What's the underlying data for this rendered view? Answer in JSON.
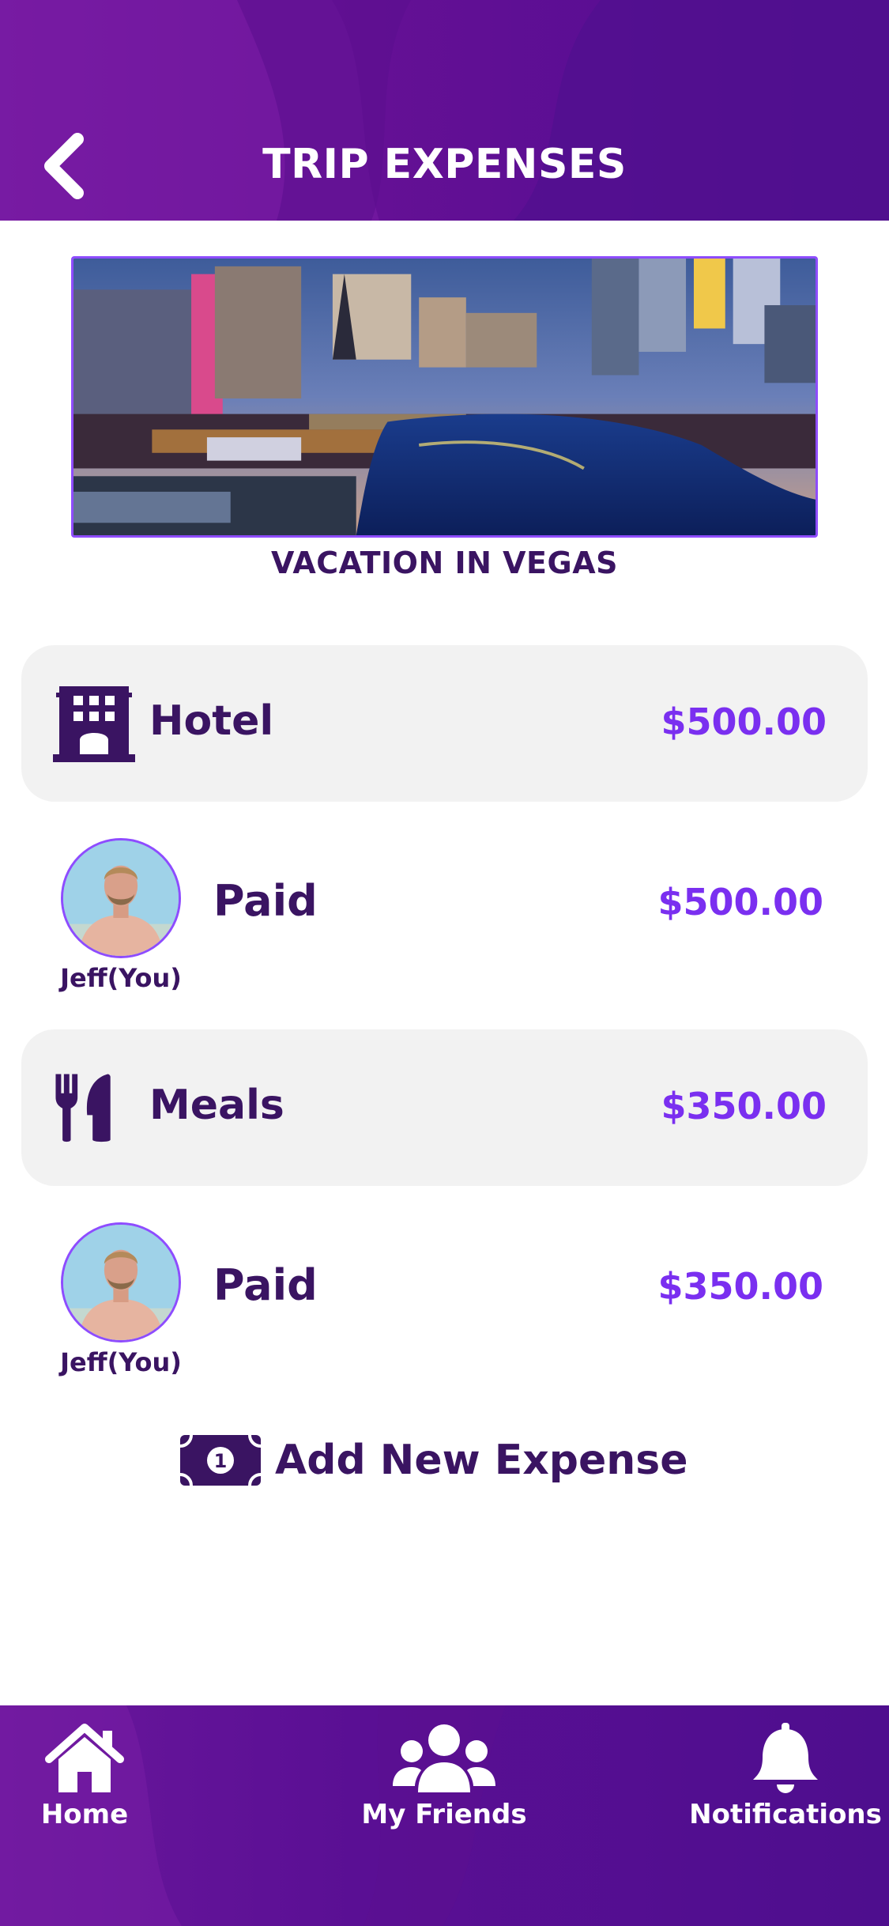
{
  "header": {
    "title": "TRIP EXPENSES",
    "back_icon": "chevron-left-icon"
  },
  "trip": {
    "name": "VACATION IN VEGAS",
    "banner_description": "Las Vegas strip skyline at dusk"
  },
  "expenses": [
    {
      "category": "Hotel",
      "icon": "hotel-icon",
      "amount": "$500.00",
      "payment": {
        "payer": "Jeff(You)",
        "status": "Paid",
        "amount": "$500.00"
      }
    },
    {
      "category": "Meals",
      "icon": "utensils-icon",
      "amount": "$350.00",
      "payment": {
        "payer": "Jeff(You)",
        "status": "Paid",
        "amount": "$350.00"
      }
    }
  ],
  "add_expense": {
    "label": "Add New Expense",
    "icon": "money-bill-icon"
  },
  "nav": {
    "items": [
      {
        "label": "Home",
        "icon": "home-icon"
      },
      {
        "label": "My Friends",
        "icon": "users-icon"
      },
      {
        "label": "Notifications",
        "icon": "bell-icon"
      }
    ]
  },
  "colors": {
    "primary_purple": "#5a0e93",
    "text_dark": "#3a1462",
    "amount_purple": "#7a2ff0",
    "card_gray": "#f2f2f2",
    "border_purple": "#8e4cff"
  }
}
